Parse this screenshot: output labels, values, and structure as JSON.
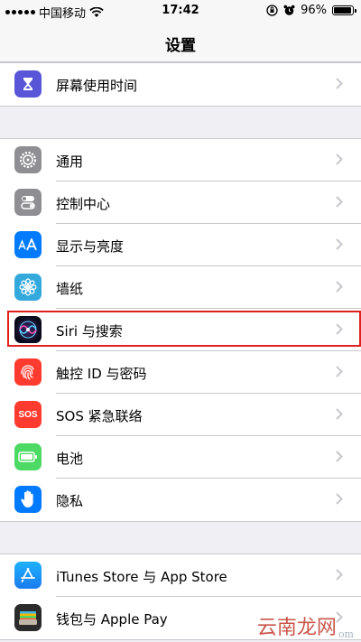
{
  "status": {
    "carrier": "中国移动",
    "time": "17:42",
    "battery": "96%",
    "battery_level": 0.96
  },
  "nav": {
    "title": "设置"
  },
  "groups": [
    {
      "items": [
        {
          "label": "屏幕使用时间",
          "icon": "hourglass-icon",
          "color": "#5856d6"
        }
      ]
    },
    {
      "items": [
        {
          "label": "通用",
          "icon": "gear-icon",
          "color": "#8e8e93"
        },
        {
          "label": "控制中心",
          "icon": "toggle-icon",
          "color": "#8e8e93"
        },
        {
          "label": "显示与亮度",
          "icon": "text-size-icon",
          "color": "#007aff"
        },
        {
          "label": "墙纸",
          "icon": "flower-icon",
          "color": "#34aadc"
        },
        {
          "label": "Siri 与搜索",
          "icon": "siri-icon",
          "color": "#1a1a2e"
        },
        {
          "label": "触控 ID 与密码",
          "icon": "fingerprint-icon",
          "color": "#ff3b30"
        },
        {
          "label": "SOS 紧急联络",
          "icon": "sos-icon",
          "color": "#ff3b30",
          "icon_text": "SOS"
        },
        {
          "label": "电池",
          "icon": "battery-icon",
          "color": "#4cd964"
        },
        {
          "label": "隐私",
          "icon": "hand-icon",
          "color": "#007aff"
        }
      ]
    },
    {
      "items": [
        {
          "label": "iTunes Store 与 App Store",
          "icon": "app-store-icon",
          "color": "#1c8ef9"
        },
        {
          "label": "钱包与 Apple Pay",
          "icon": "wallet-icon",
          "color": "#2b2b2b"
        }
      ]
    }
  ],
  "watermark": {
    "text": "云南龙网",
    "small": "om"
  }
}
